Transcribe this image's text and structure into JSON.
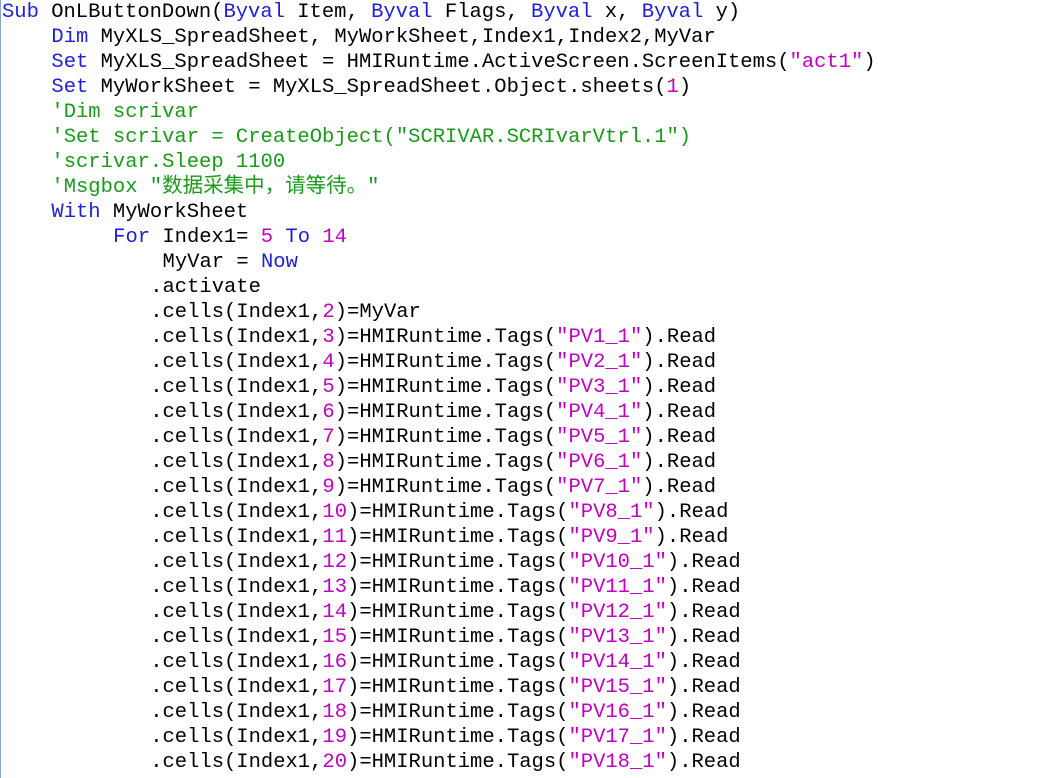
{
  "colors": {
    "keyword": "#1f1fd6",
    "comment": "#1a9a1a",
    "string": "#c000c0",
    "number": "#c000c0",
    "plain": "#000000"
  },
  "watermark": "",
  "lines": [
    {
      "indent": 0,
      "tokens": [
        [
          "k",
          "Sub"
        ],
        [
          "p",
          " OnLButtonDown("
        ],
        [
          "k",
          "Byval"
        ],
        [
          "p",
          " Item, "
        ],
        [
          "k",
          "Byval"
        ],
        [
          "p",
          " Flags, "
        ],
        [
          "k",
          "Byval"
        ],
        [
          "p",
          " x, "
        ],
        [
          "k",
          "Byval"
        ],
        [
          "p",
          " y)"
        ]
      ]
    },
    {
      "indent": 4,
      "tokens": [
        [
          "k",
          "Dim"
        ],
        [
          "p",
          " MyXLS_SpreadSheet, MyWorkSheet,Index1,Index2,MyVar"
        ]
      ]
    },
    {
      "indent": 4,
      "tokens": [
        [
          "k",
          "Set"
        ],
        [
          "p",
          " MyXLS_SpreadSheet = HMIRuntime.ActiveScreen.ScreenItems("
        ],
        [
          "s",
          "\"act1\""
        ],
        [
          "p",
          ")"
        ]
      ]
    },
    {
      "indent": 4,
      "tokens": [
        [
          "k",
          "Set"
        ],
        [
          "p",
          " MyWorkSheet = MyXLS_SpreadSheet.Object.sheets("
        ],
        [
          "n",
          "1"
        ],
        [
          "p",
          ")"
        ]
      ]
    },
    {
      "indent": 4,
      "tokens": [
        [
          "c",
          "'Dim scrivar"
        ]
      ]
    },
    {
      "indent": 4,
      "tokens": [
        [
          "c",
          "'Set scrivar = CreateObject(\"SCRIVAR.SCRIvarVtrl.1\")"
        ]
      ]
    },
    {
      "indent": 4,
      "tokens": [
        [
          "c",
          "'scrivar.Sleep 1100"
        ]
      ]
    },
    {
      "indent": 4,
      "tokens": [
        [
          "c",
          "'Msgbox \"数据采集中，请等待。\""
        ]
      ]
    },
    {
      "indent": 4,
      "tokens": [
        [
          "k",
          "With"
        ],
        [
          "p",
          " MyWorkSheet"
        ]
      ]
    },
    {
      "indent": 9,
      "tokens": [
        [
          "k",
          "For"
        ],
        [
          "p",
          " Index1= "
        ],
        [
          "n",
          "5"
        ],
        [
          "p",
          " "
        ],
        [
          "k",
          "To"
        ],
        [
          "p",
          " "
        ],
        [
          "n",
          "14"
        ]
      ]
    },
    {
      "indent": 13,
      "tokens": [
        [
          "p",
          "MyVar = "
        ],
        [
          "k",
          "Now"
        ]
      ]
    },
    {
      "indent": 12,
      "tokens": [
        [
          "p",
          ".activate"
        ]
      ]
    },
    {
      "indent": 12,
      "tokens": [
        [
          "p",
          ".cells(Index1,"
        ],
        [
          "n",
          "2"
        ],
        [
          "p",
          ")=MyVar"
        ]
      ]
    },
    {
      "indent": 12,
      "tokens": [
        [
          "p",
          ".cells(Index1,"
        ],
        [
          "n",
          "3"
        ],
        [
          "p",
          ")=HMIRuntime.Tags("
        ],
        [
          "s",
          "\"PV1_1\""
        ],
        [
          "p",
          ").Read"
        ]
      ]
    },
    {
      "indent": 12,
      "tokens": [
        [
          "p",
          ".cells(Index1,"
        ],
        [
          "n",
          "4"
        ],
        [
          "p",
          ")=HMIRuntime.Tags("
        ],
        [
          "s",
          "\"PV2_1\""
        ],
        [
          "p",
          ").Read"
        ]
      ]
    },
    {
      "indent": 12,
      "tokens": [
        [
          "p",
          ".cells(Index1,"
        ],
        [
          "n",
          "5"
        ],
        [
          "p",
          ")=HMIRuntime.Tags("
        ],
        [
          "s",
          "\"PV3_1\""
        ],
        [
          "p",
          ").Read"
        ]
      ]
    },
    {
      "indent": 12,
      "tokens": [
        [
          "p",
          ".cells(Index1,"
        ],
        [
          "n",
          "6"
        ],
        [
          "p",
          ")=HMIRuntime.Tags("
        ],
        [
          "s",
          "\"PV4_1\""
        ],
        [
          "p",
          ").Read"
        ]
      ]
    },
    {
      "indent": 12,
      "tokens": [
        [
          "p",
          ".cells(Index1,"
        ],
        [
          "n",
          "7"
        ],
        [
          "p",
          ")=HMIRuntime.Tags("
        ],
        [
          "s",
          "\"PV5_1\""
        ],
        [
          "p",
          ").Read"
        ]
      ]
    },
    {
      "indent": 12,
      "tokens": [
        [
          "p",
          ".cells(Index1,"
        ],
        [
          "n",
          "8"
        ],
        [
          "p",
          ")=HMIRuntime.Tags("
        ],
        [
          "s",
          "\"PV6_1\""
        ],
        [
          "p",
          ").Read"
        ]
      ]
    },
    {
      "indent": 12,
      "tokens": [
        [
          "p",
          ".cells(Index1,"
        ],
        [
          "n",
          "9"
        ],
        [
          "p",
          ")=HMIRuntime.Tags("
        ],
        [
          "s",
          "\"PV7_1\""
        ],
        [
          "p",
          ").Read"
        ]
      ]
    },
    {
      "indent": 12,
      "tokens": [
        [
          "p",
          ".cells(Index1,"
        ],
        [
          "n",
          "10"
        ],
        [
          "p",
          ")=HMIRuntime.Tags("
        ],
        [
          "s",
          "\"PV8_1\""
        ],
        [
          "p",
          ").Read"
        ]
      ]
    },
    {
      "indent": 12,
      "tokens": [
        [
          "p",
          ".cells(Index1,"
        ],
        [
          "n",
          "11"
        ],
        [
          "p",
          ")=HMIRuntime.Tags("
        ],
        [
          "s",
          "\"PV9_1\""
        ],
        [
          "p",
          ").Read"
        ]
      ]
    },
    {
      "indent": 12,
      "tokens": [
        [
          "p",
          ".cells(Index1,"
        ],
        [
          "n",
          "12"
        ],
        [
          "p",
          ")=HMIRuntime.Tags("
        ],
        [
          "s",
          "\"PV10_1\""
        ],
        [
          "p",
          ").Read"
        ]
      ]
    },
    {
      "indent": 12,
      "tokens": [
        [
          "p",
          ".cells(Index1,"
        ],
        [
          "n",
          "13"
        ],
        [
          "p",
          ")=HMIRuntime.Tags("
        ],
        [
          "s",
          "\"PV11_1\""
        ],
        [
          "p",
          ").Read"
        ]
      ]
    },
    {
      "indent": 12,
      "tokens": [
        [
          "p",
          ".cells(Index1,"
        ],
        [
          "n",
          "14"
        ],
        [
          "p",
          ")=HMIRuntime.Tags("
        ],
        [
          "s",
          "\"PV12_1\""
        ],
        [
          "p",
          ").Read"
        ]
      ]
    },
    {
      "indent": 12,
      "tokens": [
        [
          "p",
          ".cells(Index1,"
        ],
        [
          "n",
          "15"
        ],
        [
          "p",
          ")=HMIRuntime.Tags("
        ],
        [
          "s",
          "\"PV13_1\""
        ],
        [
          "p",
          ").Read"
        ]
      ]
    },
    {
      "indent": 12,
      "tokens": [
        [
          "p",
          ".cells(Index1,"
        ],
        [
          "n",
          "16"
        ],
        [
          "p",
          ")=HMIRuntime.Tags("
        ],
        [
          "s",
          "\"PV14_1\""
        ],
        [
          "p",
          ").Read"
        ]
      ]
    },
    {
      "indent": 12,
      "tokens": [
        [
          "p",
          ".cells(Index1,"
        ],
        [
          "n",
          "17"
        ],
        [
          "p",
          ")=HMIRuntime.Tags("
        ],
        [
          "s",
          "\"PV15_1\""
        ],
        [
          "p",
          ").Read"
        ]
      ]
    },
    {
      "indent": 12,
      "tokens": [
        [
          "p",
          ".cells(Index1,"
        ],
        [
          "n",
          "18"
        ],
        [
          "p",
          ")=HMIRuntime.Tags("
        ],
        [
          "s",
          "\"PV16_1\""
        ],
        [
          "p",
          ").Read"
        ]
      ]
    },
    {
      "indent": 12,
      "tokens": [
        [
          "p",
          ".cells(Index1,"
        ],
        [
          "n",
          "19"
        ],
        [
          "p",
          ")=HMIRuntime.Tags("
        ],
        [
          "s",
          "\"PV17_1\""
        ],
        [
          "p",
          ").Read"
        ]
      ]
    },
    {
      "indent": 12,
      "tokens": [
        [
          "p",
          ".cells(Index1,"
        ],
        [
          "n",
          "20"
        ],
        [
          "p",
          ")=HMIRuntime.Tags("
        ],
        [
          "s",
          "\"PV18_1\""
        ],
        [
          "p",
          ").Read"
        ]
      ]
    }
  ]
}
